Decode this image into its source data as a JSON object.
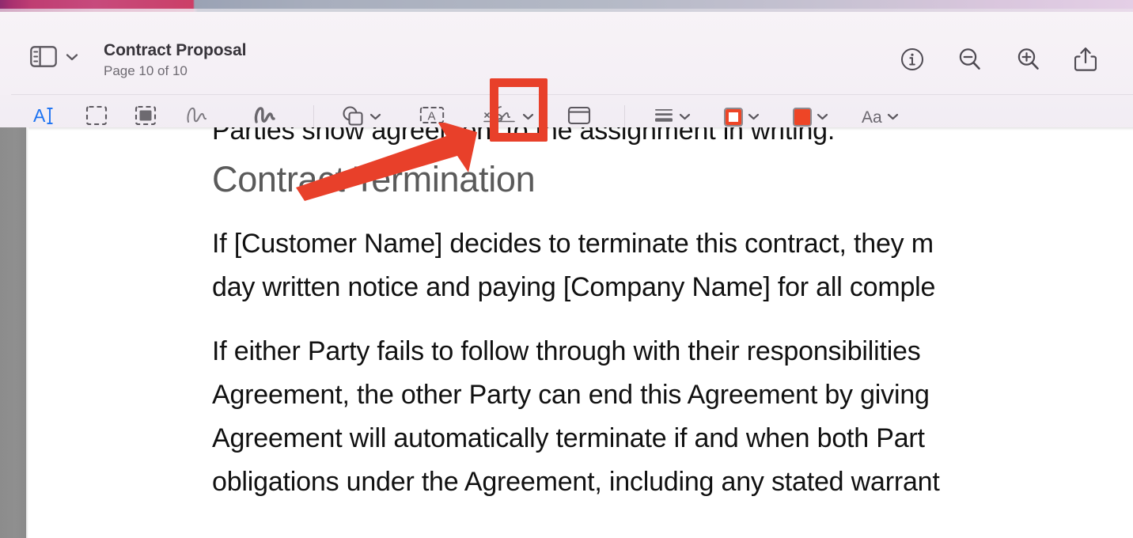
{
  "window": {
    "title": "Contract Proposal",
    "subtitle": "Page 10 of 10"
  },
  "titlebar": {
    "sidebar_toggle_icon": "sidebar-panel-icon",
    "sidebar_toggle_chevron": "chevron-down-icon",
    "actions": [
      {
        "name": "info-icon",
        "label": "Info"
      },
      {
        "name": "zoom-out-icon",
        "label": "Zoom Out"
      },
      {
        "name": "zoom-in-icon",
        "label": "Zoom In"
      },
      {
        "name": "share-icon",
        "label": "Share"
      }
    ]
  },
  "markup_toolbar": {
    "tools": [
      {
        "name": "text-selection-tool",
        "label": "Text Selection",
        "icon": "text-cursor-icon",
        "active": true
      },
      {
        "name": "rectangular-selection-tool",
        "label": "Rectangular Selection",
        "icon": "dashed-rectangle-icon",
        "active": false
      },
      {
        "name": "instant-alpha-tool",
        "label": "Instant Alpha",
        "icon": "filled-dashed-rectangle-icon",
        "active": false
      },
      {
        "name": "sketch-tool",
        "label": "Sketch",
        "icon": "sketch-squiggle-icon",
        "active": false
      },
      {
        "name": "draw-tool",
        "label": "Draw",
        "icon": "draw-squiggle-icon",
        "active": false
      },
      {
        "name": "shapes-tool",
        "label": "Shapes",
        "icon": "shapes-icon",
        "has_chevron": true,
        "active": false
      },
      {
        "name": "text-tool",
        "label": "Text",
        "icon": "text-box-a-icon",
        "active": false
      },
      {
        "name": "sign-tool",
        "label": "Sign",
        "icon": "signature-icon",
        "has_chevron": true,
        "active": false,
        "highlighted": true
      },
      {
        "name": "note-tool",
        "label": "Note",
        "icon": "note-window-icon",
        "active": false
      },
      {
        "name": "shape-style-tool",
        "label": "Shape Style",
        "icon": "line-thickness-icon",
        "has_chevron": true,
        "active": false
      },
      {
        "name": "border-color-tool",
        "label": "Border Color",
        "icon": "border-color-swatch-icon",
        "has_chevron": true,
        "active": false
      },
      {
        "name": "fill-color-tool",
        "label": "Fill Color",
        "icon": "fill-color-swatch-icon",
        "has_chevron": true,
        "active": false
      },
      {
        "name": "text-style-tool",
        "label": "Aa",
        "icon": "text-style-icon",
        "has_chevron": true,
        "active": false
      }
    ],
    "colors": {
      "border_swatch": "#ee4526",
      "fill_swatch": "#ee4526",
      "active_tool": "#1b72f2"
    }
  },
  "document": {
    "clipped_top_line": "Parties show agreement to the assignment in writing.",
    "heading": "Contract Termination",
    "paragraph1_line1": "If [Customer Name] decides to terminate this contract, they m",
    "paragraph1_line2": "day written notice and paying [Company Name] for all comple",
    "paragraph2_line1": "If either Party fails to follow through with their responsibilities",
    "paragraph2_line2": "Agreement, the other Party can end this Agreement by giving",
    "paragraph2_line3": "Agreement will automatically terminate if and when both Part",
    "paragraph2_line4": "obligations under the Agreement, including any stated warrant"
  },
  "annotations": {
    "highlight_box": {
      "name": "sign-tool-highlight-box",
      "color": "#e8402a"
    },
    "pointer_arrow": {
      "name": "pointer-arrow",
      "color": "#e8402a"
    }
  }
}
